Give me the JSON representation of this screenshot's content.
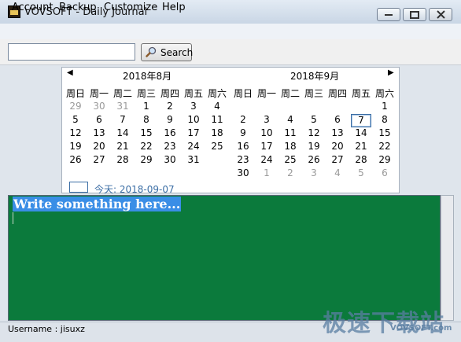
{
  "window": {
    "title": "VOVSOFT - Daily Journal"
  },
  "menu": [
    "Account",
    "Backup",
    "Customize",
    "Help"
  ],
  "search": {
    "value": "",
    "button_label": "Search"
  },
  "calendar": {
    "left": {
      "title": "2018年8月",
      "weekdays": [
        "周日",
        "周一",
        "周二",
        "周三",
        "周四",
        "周五",
        "周六"
      ],
      "weeks": [
        [
          {
            "d": "29",
            "other": true
          },
          {
            "d": "30",
            "other": true
          },
          {
            "d": "31",
            "other": true
          },
          {
            "d": "1"
          },
          {
            "d": "2"
          },
          {
            "d": "3"
          },
          {
            "d": "4"
          }
        ],
        [
          {
            "d": "5"
          },
          {
            "d": "6"
          },
          {
            "d": "7"
          },
          {
            "d": "8"
          },
          {
            "d": "9"
          },
          {
            "d": "10"
          },
          {
            "d": "11"
          }
        ],
        [
          {
            "d": "12"
          },
          {
            "d": "13"
          },
          {
            "d": "14"
          },
          {
            "d": "15"
          },
          {
            "d": "16"
          },
          {
            "d": "17"
          },
          {
            "d": "18"
          }
        ],
        [
          {
            "d": "19"
          },
          {
            "d": "20"
          },
          {
            "d": "21"
          },
          {
            "d": "22"
          },
          {
            "d": "23"
          },
          {
            "d": "24"
          },
          {
            "d": "25"
          }
        ],
        [
          {
            "d": "26"
          },
          {
            "d": "27"
          },
          {
            "d": "28"
          },
          {
            "d": "29"
          },
          {
            "d": "30"
          },
          {
            "d": "31"
          }
        ]
      ]
    },
    "right": {
      "title": "2018年9月",
      "weekdays": [
        "周日",
        "周一",
        "周二",
        "周三",
        "周四",
        "周五",
        "周六"
      ],
      "weeks": [
        [
          {
            "d": ""
          },
          {
            "d": ""
          },
          {
            "d": ""
          },
          {
            "d": ""
          },
          {
            "d": ""
          },
          {
            "d": ""
          },
          {
            "d": "1"
          }
        ],
        [
          {
            "d": "2"
          },
          {
            "d": "3"
          },
          {
            "d": "4"
          },
          {
            "d": "5"
          },
          {
            "d": "6"
          },
          {
            "d": "7",
            "selected": true
          },
          {
            "d": "8"
          }
        ],
        [
          {
            "d": "9"
          },
          {
            "d": "10"
          },
          {
            "d": "11"
          },
          {
            "d": "12"
          },
          {
            "d": "13"
          },
          {
            "d": "14"
          },
          {
            "d": "15"
          }
        ],
        [
          {
            "d": "16"
          },
          {
            "d": "17"
          },
          {
            "d": "18"
          },
          {
            "d": "19"
          },
          {
            "d": "20"
          },
          {
            "d": "21"
          },
          {
            "d": "22"
          }
        ],
        [
          {
            "d": "23"
          },
          {
            "d": "24"
          },
          {
            "d": "25"
          },
          {
            "d": "26"
          },
          {
            "d": "27"
          },
          {
            "d": "28"
          },
          {
            "d": "29"
          }
        ],
        [
          {
            "d": "30"
          },
          {
            "d": "1",
            "other": true
          },
          {
            "d": "2",
            "other": true
          },
          {
            "d": "3",
            "other": true
          },
          {
            "d": "4",
            "other": true
          },
          {
            "d": "5",
            "other": true
          },
          {
            "d": "6",
            "other": true
          }
        ]
      ]
    },
    "today_label": "今天: 2018-09-07"
  },
  "editor": {
    "text": "Write something here...",
    "background": "#0b7a3c",
    "selection": "#3a8ee6"
  },
  "status": {
    "text": "Username : jisuxz"
  },
  "watermark": {
    "main": "极速下载站",
    "sub": "VOVSOFT.com"
  }
}
